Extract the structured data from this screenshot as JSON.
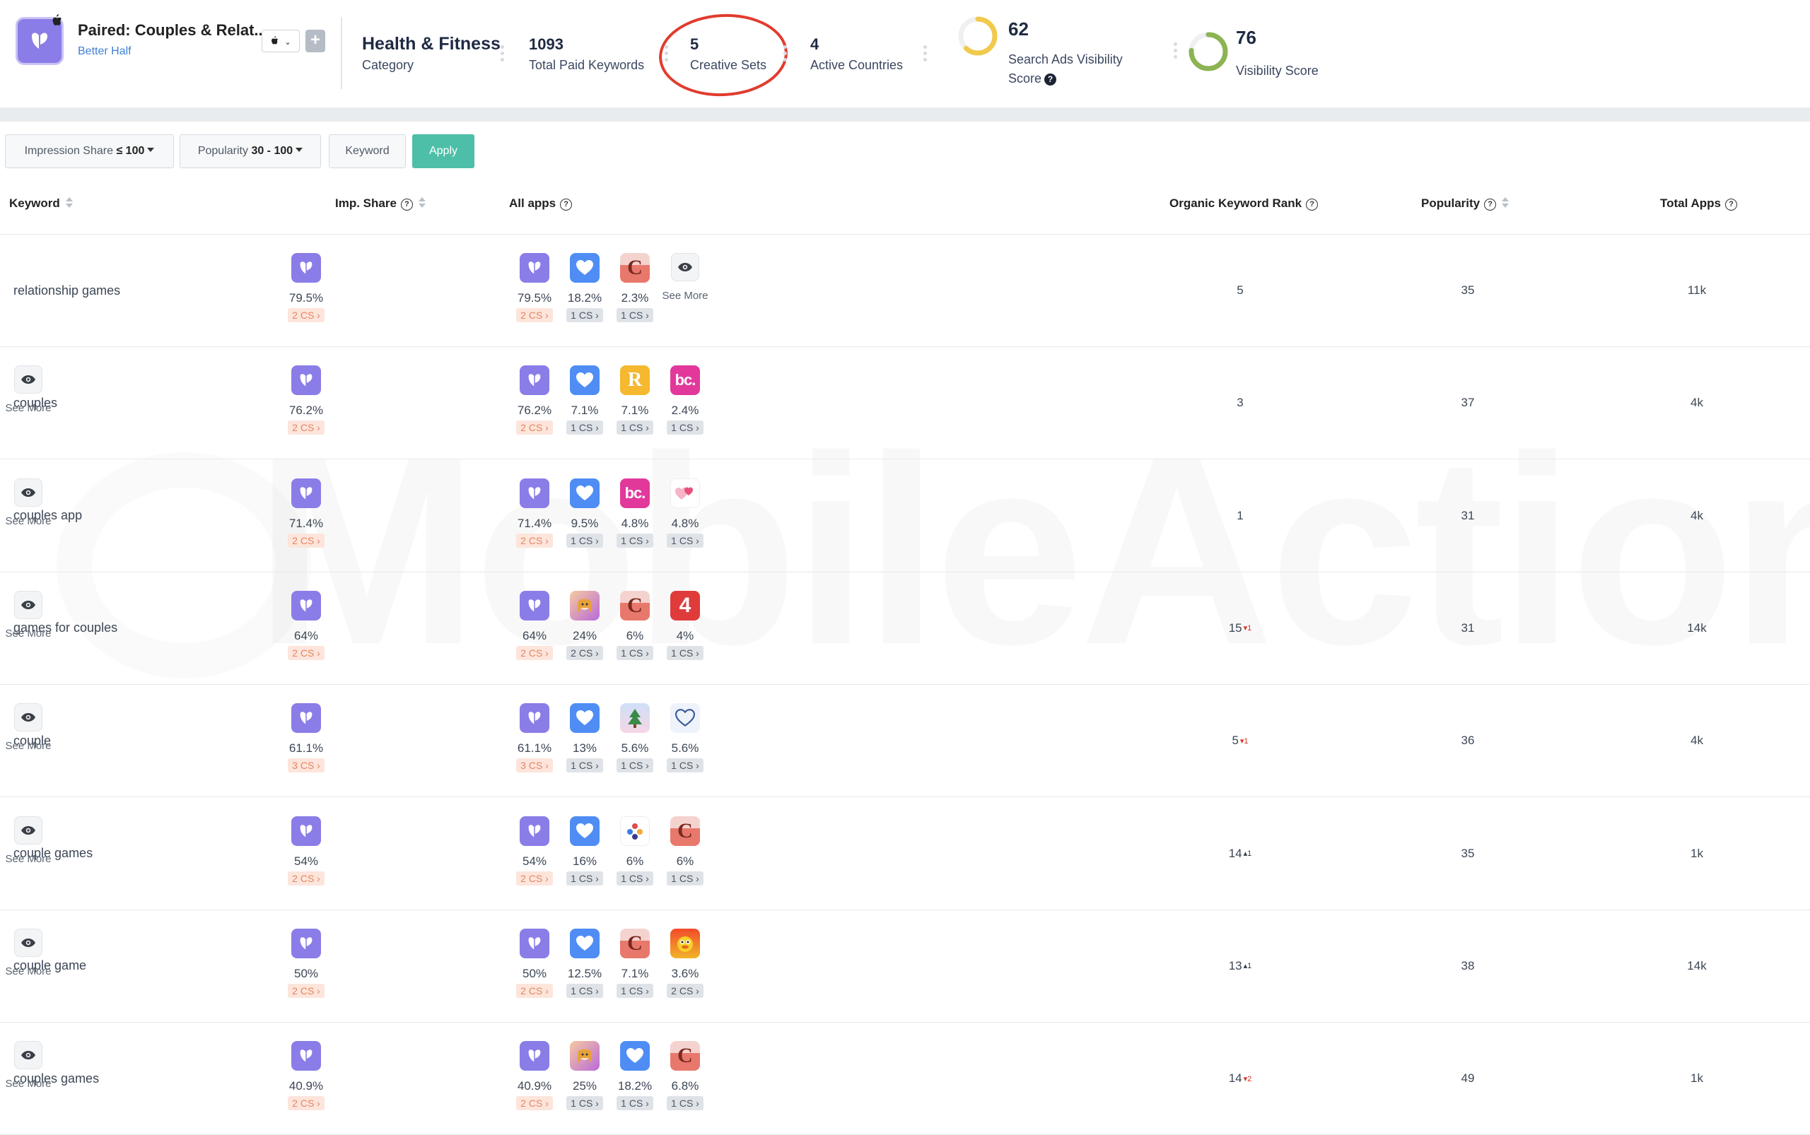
{
  "app": {
    "name": "Paired: Couples & Relat...",
    "developer": "Better Half",
    "store_label": "",
    "category_value": "Health & Fitness",
    "category_label": "Category"
  },
  "metrics": {
    "paid_keywords": {
      "value": "1093",
      "label": "Total Paid Keywords"
    },
    "creative_sets": {
      "value": "5",
      "label": "Creative Sets"
    },
    "active_countries": {
      "value": "4",
      "label": "Active Countries"
    },
    "search_ads_visibility": {
      "value": "62",
      "label_line1": "Search Ads Visibility",
      "label_line2": "Score",
      "ring_color": "#f2c94c",
      "ring_fraction": 0.62
    },
    "visibility_score": {
      "value": "76",
      "label": "Visibility Score",
      "ring_color": "#8cb453",
      "ring_fraction": 0.76
    }
  },
  "filters": {
    "impression_share": {
      "label": "Impression Share",
      "value": "≤ 100"
    },
    "popularity": {
      "label": "Popularity",
      "value": "30 - 100"
    },
    "keyword": "Keyword",
    "apply": "Apply"
  },
  "columns": {
    "keyword": "Keyword",
    "imp_share": "Imp. Share",
    "all_apps": "All apps",
    "organic_rank": "Organic Keyword Rank",
    "popularity": "Popularity",
    "total_apps": "Total Apps"
  },
  "watermark": "MobileAction",
  "see_more": "See More",
  "colors": {
    "accent": "#4dbfa8",
    "brand": "#8a7de8",
    "highlight": "#e03c2e"
  },
  "rows": [
    {
      "keyword": "relationship games",
      "imp": {
        "pct": "79.5%",
        "cs": "2 CS ›"
      },
      "apps": [
        {
          "icon": "paired",
          "pct": "79.5%",
          "cs": "2 CS ›",
          "main": true
        },
        {
          "icon": "heart-blue",
          "pct": "18.2%",
          "cs": "1 CS ›"
        },
        {
          "icon": "c-app",
          "pct": "2.3%",
          "cs": "1 CS ›"
        }
      ],
      "rank": "5",
      "delta": "",
      "popularity": "35",
      "total": "11k"
    },
    {
      "keyword": "couples",
      "imp": {
        "pct": "76.2%",
        "cs": "2 CS ›"
      },
      "apps": [
        {
          "icon": "paired",
          "pct": "76.2%",
          "cs": "2 CS ›",
          "main": true
        },
        {
          "icon": "heart-blue",
          "pct": "7.1%",
          "cs": "1 CS ›"
        },
        {
          "icon": "r-app",
          "pct": "7.1%",
          "cs": "1 CS ›"
        },
        {
          "icon": "bc-app",
          "pct": "2.4%",
          "cs": "1 CS ›"
        }
      ],
      "rank": "3",
      "delta": "",
      "popularity": "37",
      "total": "4k"
    },
    {
      "keyword": "couples app",
      "imp": {
        "pct": "71.4%",
        "cs": "2 CS ›"
      },
      "apps": [
        {
          "icon": "paired",
          "pct": "71.4%",
          "cs": "2 CS ›",
          "main": true
        },
        {
          "icon": "heart-blue",
          "pct": "9.5%",
          "cs": "1 CS ›"
        },
        {
          "icon": "bc-app",
          "pct": "4.8%",
          "cs": "1 CS ›"
        },
        {
          "icon": "hearts-pink",
          "pct": "4.8%",
          "cs": "1 CS ›"
        }
      ],
      "rank": "1",
      "delta": "",
      "popularity": "31",
      "total": "4k"
    },
    {
      "keyword": "games for couples",
      "imp": {
        "pct": "64%",
        "cs": "2 CS ›"
      },
      "apps": [
        {
          "icon": "paired",
          "pct": "64%",
          "cs": "2 CS ›",
          "main": true
        },
        {
          "icon": "game-girl",
          "pct": "24%",
          "cs": "2 CS ›"
        },
        {
          "icon": "c-app",
          "pct": "6%",
          "cs": "1 CS ›"
        },
        {
          "icon": "four-app",
          "pct": "4%",
          "cs": "1 CS ›"
        }
      ],
      "rank": "15",
      "delta": "▾1",
      "delta_dir": "down",
      "popularity": "31",
      "total": "14k"
    },
    {
      "keyword": "couple",
      "imp": {
        "pct": "61.1%",
        "cs": "3 CS ›"
      },
      "apps": [
        {
          "icon": "paired",
          "pct": "61.1%",
          "cs": "3 CS ›",
          "main": true
        },
        {
          "icon": "heart-blue",
          "pct": "13%",
          "cs": "1 CS ›"
        },
        {
          "icon": "tree-app",
          "pct": "5.6%",
          "cs": "1 CS ›"
        },
        {
          "icon": "heart-outline",
          "pct": "5.6%",
          "cs": "1 CS ›"
        }
      ],
      "rank": "5",
      "delta": "▾1",
      "delta_dir": "down",
      "popularity": "36",
      "total": "4k"
    },
    {
      "keyword": "couple games",
      "imp": {
        "pct": "54%",
        "cs": "2 CS ›"
      },
      "apps": [
        {
          "icon": "paired",
          "pct": "54%",
          "cs": "2 CS ›",
          "main": true
        },
        {
          "icon": "heart-blue",
          "pct": "16%",
          "cs": "1 CS ›"
        },
        {
          "icon": "dots-app",
          "pct": "6%",
          "cs": "1 CS ›"
        },
        {
          "icon": "c-app",
          "pct": "6%",
          "cs": "1 CS ›"
        }
      ],
      "rank": "14",
      "delta": "▴1",
      "delta_dir": "up",
      "popularity": "35",
      "total": "1k"
    },
    {
      "keyword": "couple game",
      "imp": {
        "pct": "50%",
        "cs": "2 CS ›"
      },
      "apps": [
        {
          "icon": "paired",
          "pct": "50%",
          "cs": "2 CS ›",
          "main": true
        },
        {
          "icon": "heart-blue",
          "pct": "12.5%",
          "cs": "1 CS ›"
        },
        {
          "icon": "c-app",
          "pct": "7.1%",
          "cs": "1 CS ›"
        },
        {
          "icon": "duck-app",
          "pct": "3.6%",
          "cs": "2 CS ›"
        }
      ],
      "rank": "13",
      "delta": "▴1",
      "delta_dir": "up",
      "popularity": "38",
      "total": "14k"
    },
    {
      "keyword": "couples games",
      "imp": {
        "pct": "40.9%",
        "cs": "2 CS ›"
      },
      "apps": [
        {
          "icon": "paired",
          "pct": "40.9%",
          "cs": "2 CS ›",
          "main": true
        },
        {
          "icon": "game-girl",
          "pct": "25%",
          "cs": "1 CS ›"
        },
        {
          "icon": "heart-blue",
          "pct": "18.2%",
          "cs": "1 CS ›"
        },
        {
          "icon": "c-app",
          "pct": "6.8%",
          "cs": "1 CS ›"
        }
      ],
      "rank": "14",
      "delta": "▾2",
      "delta_dir": "down",
      "popularity": "49",
      "total": "1k"
    }
  ]
}
